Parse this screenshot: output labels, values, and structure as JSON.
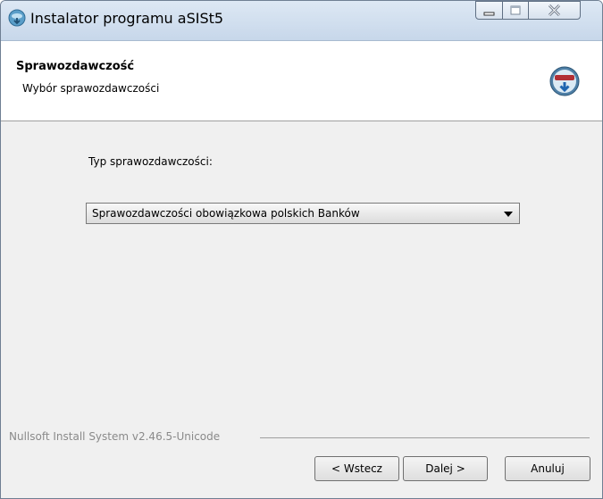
{
  "window": {
    "title": "Instalator programu aSISt5",
    "icon": "installer-icon"
  },
  "header": {
    "title": "Sprawozdawczość",
    "subtitle": "Wybór sprawozdawczości",
    "logo": "asist-logo-icon"
  },
  "form": {
    "type_label": "Typ sprawozdawczości:",
    "selected_value": "Sprawozdawczości obowiązkowa polskich Banków"
  },
  "footer": {
    "branding": "Nullsoft Install System v2.46.5-Unicode",
    "back_label": "< Wstecz",
    "next_label": "Dalej >",
    "cancel_label": "Anuluj"
  },
  "colors": {
    "titlebar": "#c7d7ea",
    "content_bg": "#f0f0f0",
    "close_button": "#d6dfea"
  }
}
